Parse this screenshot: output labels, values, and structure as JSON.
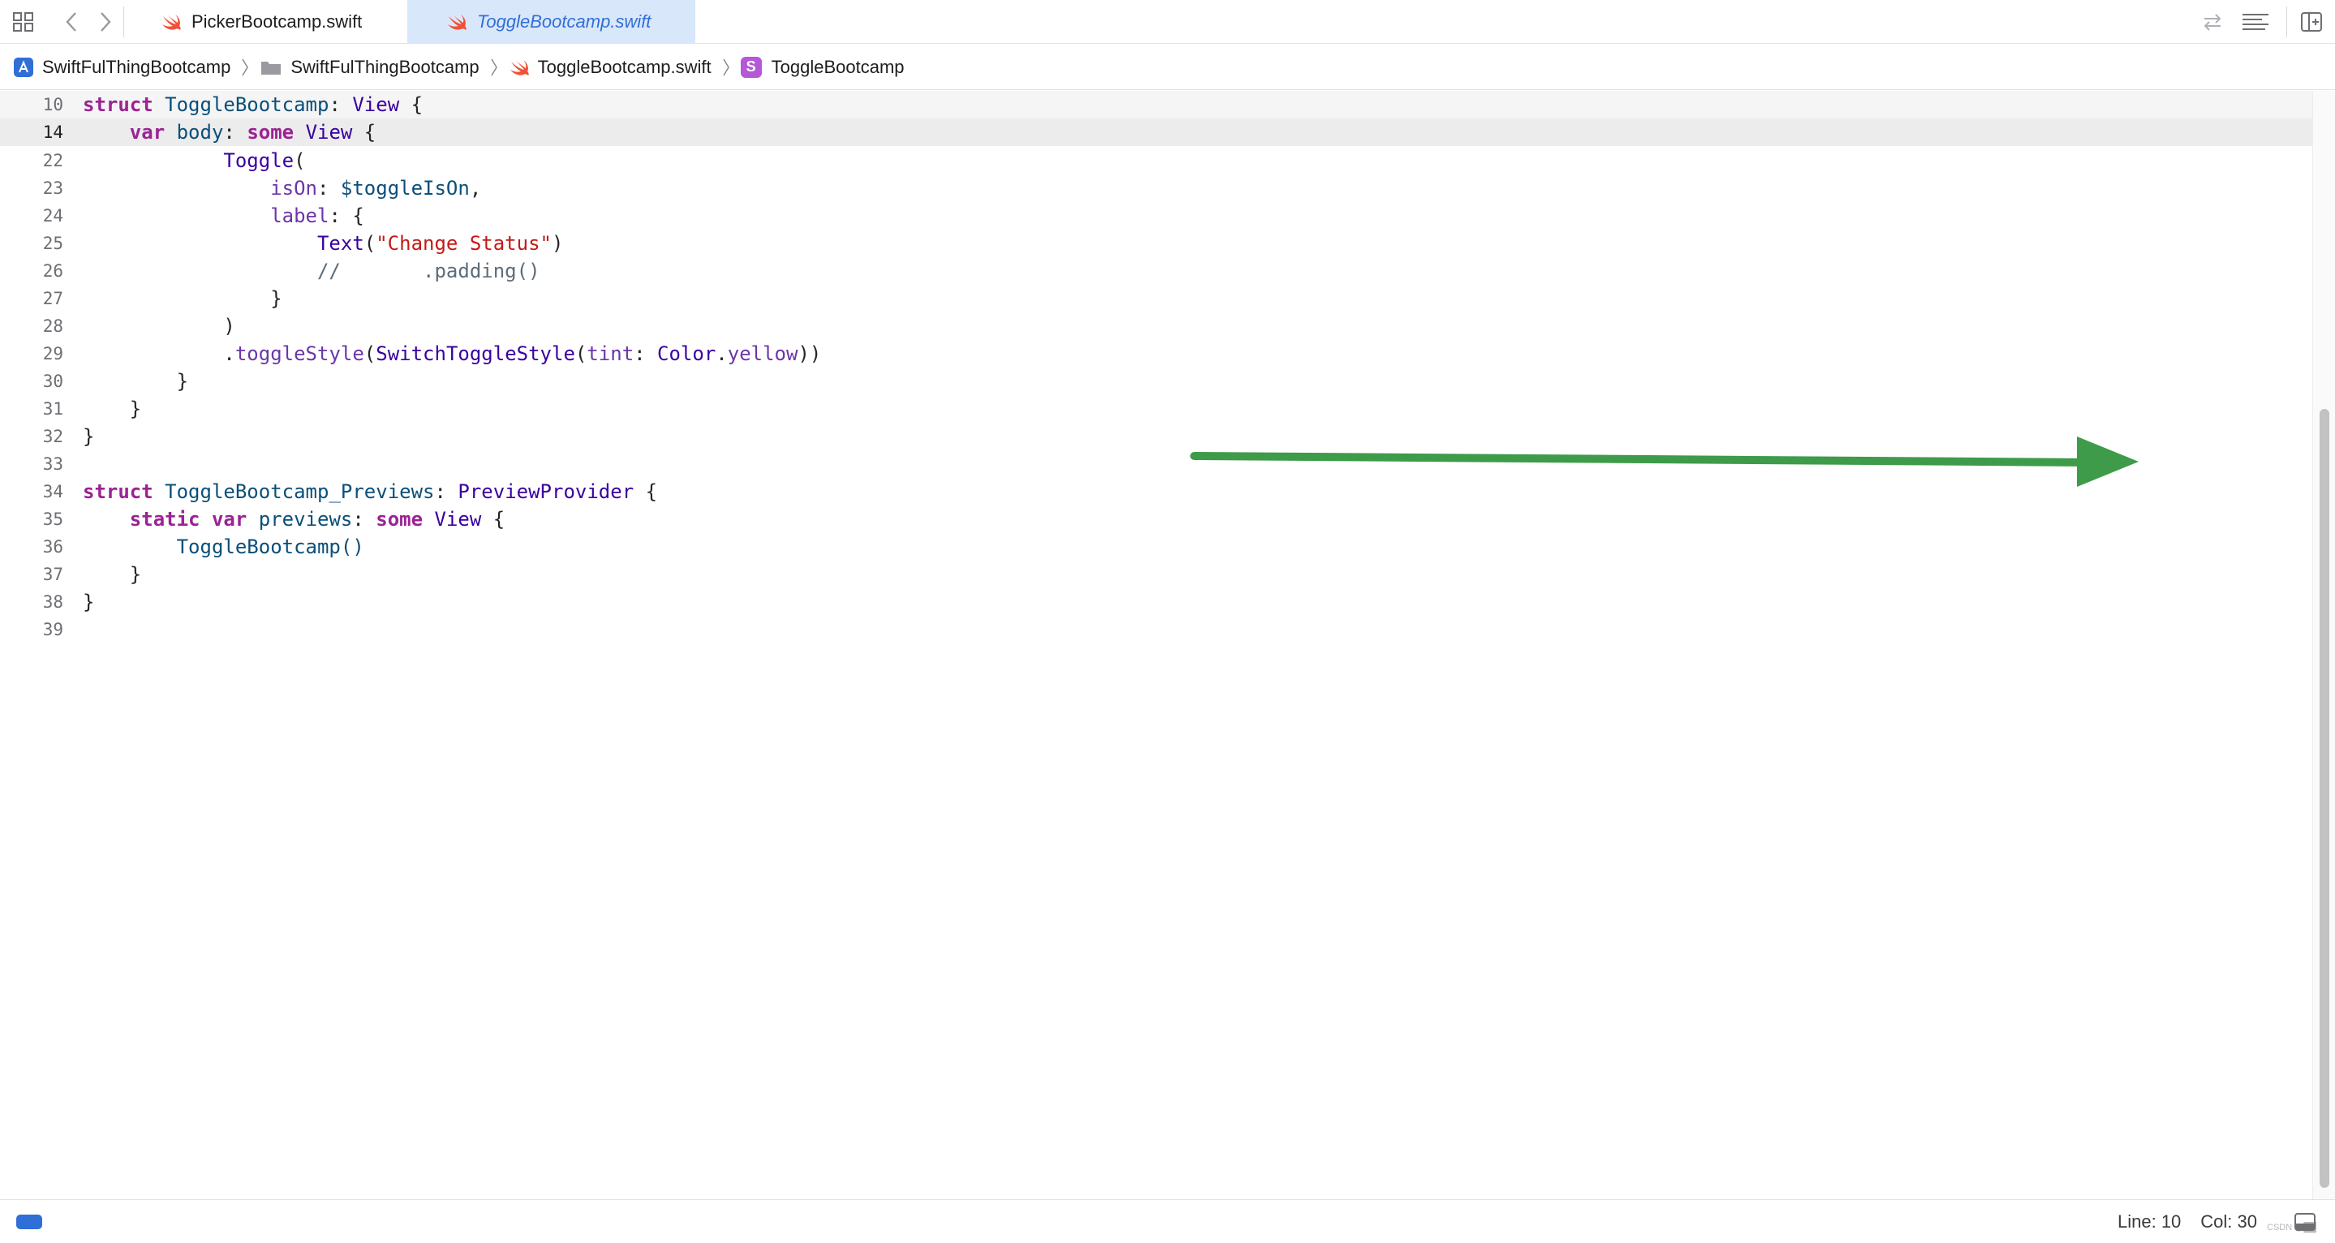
{
  "tabs": [
    {
      "label": "PickerBootcamp.swift",
      "active": false
    },
    {
      "label": "ToggleBootcamp.swift",
      "active": true
    }
  ],
  "breadcrumb": [
    {
      "label": "SwiftFulThingBootcamp",
      "icon": "app-project-icon"
    },
    {
      "label": "SwiftFulThingBootcamp",
      "icon": "folder-icon"
    },
    {
      "label": "ToggleBootcamp.swift",
      "icon": "swift-file-icon"
    },
    {
      "label": "ToggleBootcamp",
      "icon": "struct-icon",
      "badge": "S"
    }
  ],
  "code": {
    "lines": [
      {
        "num": "10",
        "sticky": true
      },
      {
        "num": "14",
        "sticky": true
      },
      {
        "num": "22"
      },
      {
        "num": "23"
      },
      {
        "num": "24"
      },
      {
        "num": "25"
      },
      {
        "num": "26"
      },
      {
        "num": "27"
      },
      {
        "num": "28"
      },
      {
        "num": "29"
      },
      {
        "num": "30"
      },
      {
        "num": "31"
      },
      {
        "num": "32"
      },
      {
        "num": "33"
      },
      {
        "num": "34"
      },
      {
        "num": "35"
      },
      {
        "num": "36"
      },
      {
        "num": "37"
      },
      {
        "num": "38"
      },
      {
        "num": "39"
      }
    ],
    "tokens": {
      "struct": "struct",
      "var": "var",
      "static": "static",
      "some": "some",
      "toggle_bootcamp": "ToggleBootcamp",
      "view": "View",
      "body": "body",
      "toggle": "Toggle",
      "is_on": "isOn",
      "toggle_is_on": "$toggleIsOn",
      "label": "label",
      "text": "Text",
      "change_status": "\"Change Status\"",
      "comment": "//       .padding()",
      "toggle_style": "toggleStyle",
      "switch_toggle_style": "SwitchToggleStyle",
      "tint": "tint",
      "color": "Color",
      "yellow": "yellow",
      "previews_struct": "ToggleBootcamp_Previews",
      "preview_provider": "PreviewProvider",
      "previews": "previews",
      "toggle_bootcamp_call": "ToggleBootcamp()"
    }
  },
  "status": {
    "line": "Line: 10",
    "col": "Col: 30",
    "watermark": "CSDN @██"
  },
  "colors": {
    "accent": "#2f6fd6",
    "annotation_arrow": "#3d9b4a",
    "keyword": "#9b2393",
    "string": "#c41a16"
  }
}
